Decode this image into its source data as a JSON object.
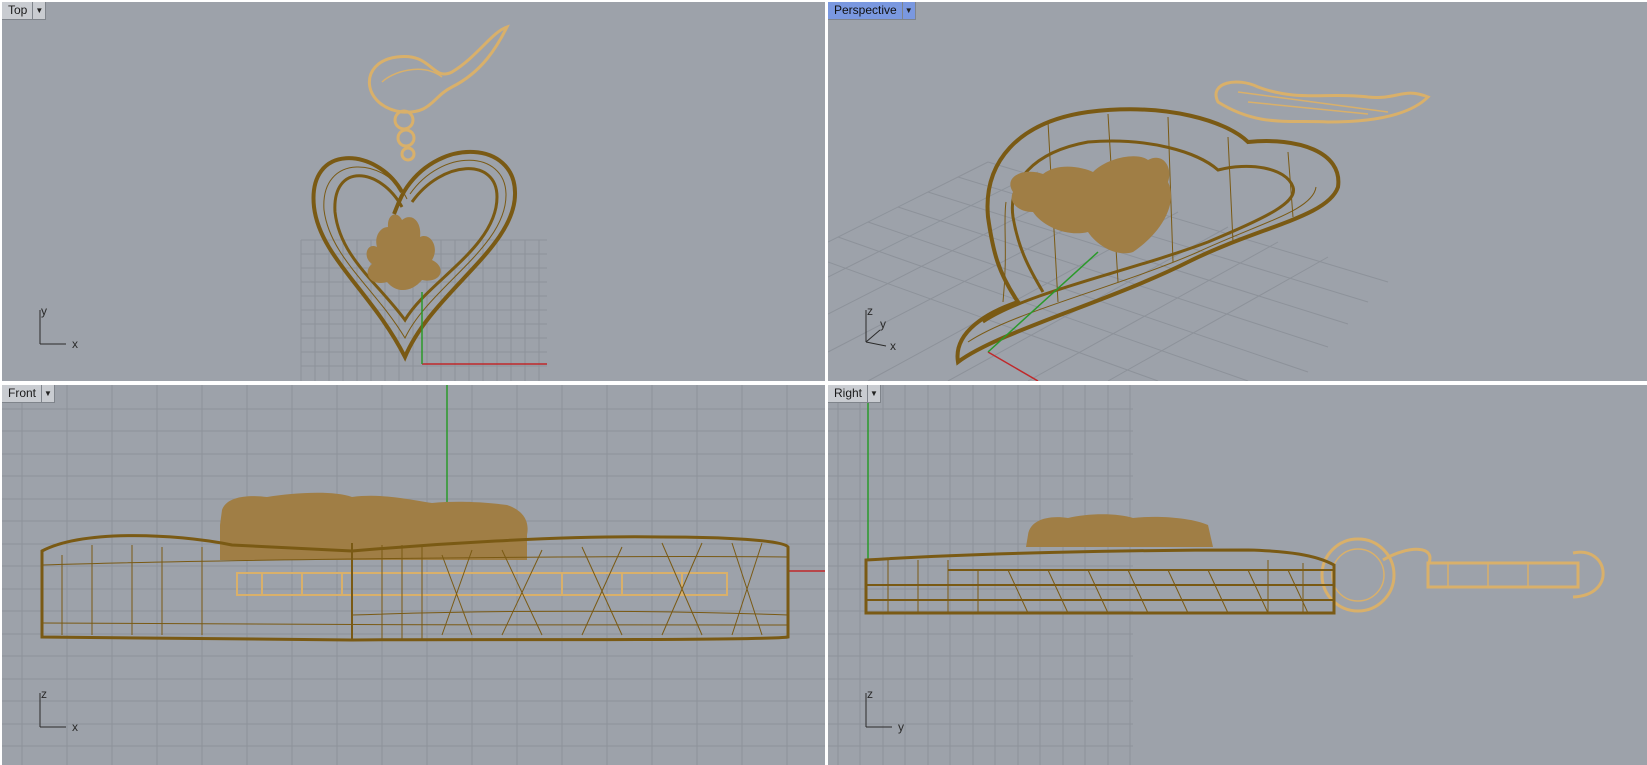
{
  "viewports": {
    "top": {
      "title": "Top",
      "axes": [
        "y",
        "x"
      ]
    },
    "persp": {
      "title": "Perspective",
      "axes": [
        "z",
        "y",
        "x"
      ]
    },
    "front": {
      "title": "Front",
      "axes": [
        "z",
        "x"
      ]
    },
    "right": {
      "title": "Right",
      "axes": [
        "z",
        "y"
      ]
    }
  },
  "icons": {
    "view_menu": "dropdown-arrow-icon"
  },
  "colors": {
    "viewport_bg": "#9da2aa",
    "grid": "#8b9098",
    "wireframe": "#7a5a14",
    "solid": "#a07e45",
    "ghost": "#d9b06a",
    "x_axis": "#c0282a",
    "y_axis": "#2a9a2a",
    "active_tab": "#7a98e0"
  }
}
